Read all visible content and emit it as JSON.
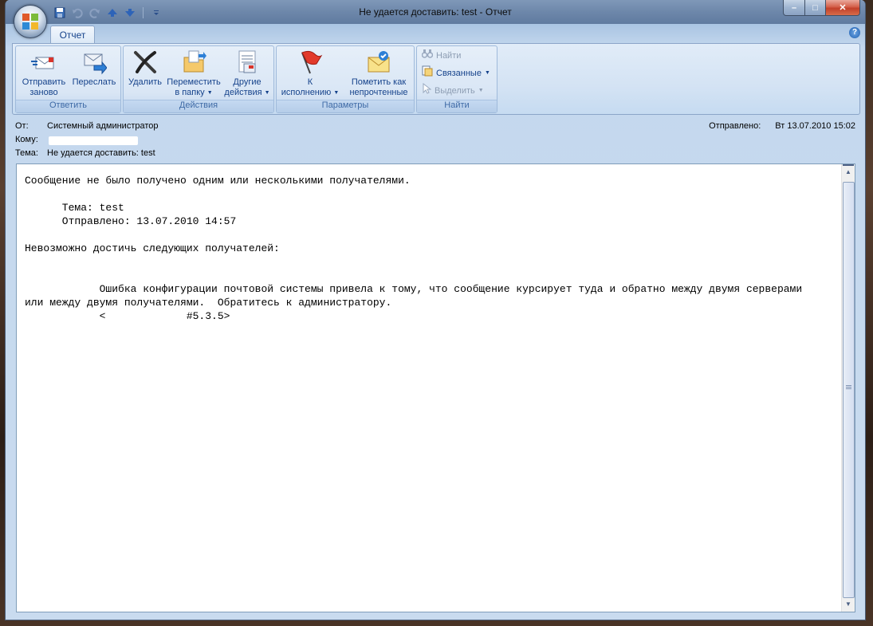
{
  "window": {
    "title": "Не удается доставить: test - Отчет",
    "buttons": {
      "minimize": "–",
      "maximize": "□",
      "close": "✕"
    }
  },
  "quick_access": [
    "save-icon",
    "undo-icon",
    "redo-icon",
    "previous-item-icon",
    "next-item-icon",
    "customize-icon"
  ],
  "ribbon": {
    "tab": "Отчет",
    "help": "?",
    "groups": {
      "respond": {
        "label": "Ответить",
        "resend": {
          "line1": "Отправить",
          "line2": "заново"
        },
        "forward": {
          "line1": "Переслать",
          "line2": ""
        }
      },
      "actions": {
        "label": "Действия",
        "delete": {
          "line1": "Удалить",
          "line2": ""
        },
        "move": {
          "line1": "Переместить",
          "line2": "в папку"
        },
        "other": {
          "line1": "Другие",
          "line2": "действия"
        }
      },
      "options": {
        "label": "Параметры",
        "followup": {
          "line1": "К",
          "line2": "исполнению"
        },
        "unread": {
          "line1": "Пометить как",
          "line2": "непрочтенные"
        }
      },
      "find": {
        "label": "Найти",
        "find": "Найти",
        "related": "Связанные",
        "select": "Выделить"
      }
    }
  },
  "message": {
    "from_label": "От:",
    "from": "Системный администратор",
    "to_label": "Кому:",
    "subject_label": "Тема:",
    "subject": "Не удается доставить: test",
    "sent_label": "Отправлено:",
    "sent": "Вт 13.07.2010 15:02",
    "body": "Сообщение не было получено одним или несколькими получателями.\n\n      Тема: test\n      Отправлено: 13.07.2010 14:57\n\nНевозможно достичь следующих получателей:\n\n\n            Ошибка конфигурации почтовой системы привела к тому, что сообщение курсирует туда и обратно между двумя серверами\nили между двумя получателями.  Обратитесь к администратору.\n            <             #5.3.5>"
  },
  "colors": {
    "accent": "#15428b",
    "ribbon_bg": "#dbe8f6",
    "group_label": "#3e6aa6"
  }
}
